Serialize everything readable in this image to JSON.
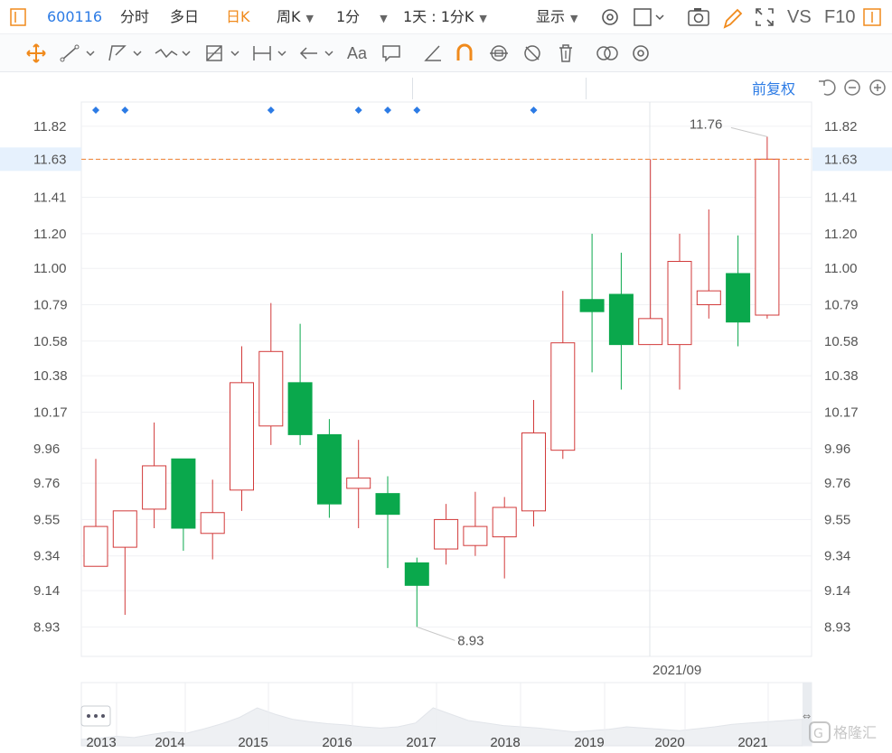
{
  "toolbar": {
    "code": "600116",
    "tab_fenshi": "分时",
    "tab_duori": "多日",
    "tab_rik": "日K",
    "tab_zhouk": "周K",
    "tab_1fen": "1分",
    "tab_1tian": "1天 : 1分K",
    "display": "显示",
    "vs": "VS",
    "f10": "F10"
  },
  "chart_header": {
    "adjust": "前复权"
  },
  "colors": {
    "up": "#d23a3a",
    "down": "#0aa84c",
    "accent": "#2c7be5",
    "highlight": "#f08030"
  },
  "chart_data": {
    "type": "candlestick",
    "xlabel": "",
    "ylabel": "",
    "ylim": [
      8.76,
      11.96
    ],
    "y_ticks": [
      "11.82",
      "11.63",
      "11.41",
      "11.20",
      "11.00",
      "10.79",
      "10.58",
      "10.38",
      "10.17",
      "9.96",
      "9.76",
      "9.55",
      "9.34",
      "9.14",
      "8.93"
    ],
    "current_price": "11.63",
    "max_label": "11.76",
    "min_label": "8.93",
    "crosshair_date": "2021/09",
    "marker_indices": [
      0,
      1,
      6,
      9,
      10,
      11,
      15
    ],
    "candles": [
      {
        "open": 9.28,
        "close": 9.51,
        "high": 9.9,
        "low": 9.28
      },
      {
        "open": 9.39,
        "close": 9.6,
        "high": 9.6,
        "low": 9.0
      },
      {
        "open": 9.61,
        "close": 9.86,
        "high": 10.11,
        "low": 9.5
      },
      {
        "open": 9.9,
        "close": 9.5,
        "high": 9.9,
        "low": 9.37
      },
      {
        "open": 9.47,
        "close": 9.59,
        "high": 9.78,
        "low": 9.32
      },
      {
        "open": 9.72,
        "close": 10.34,
        "high": 10.55,
        "low": 9.6
      },
      {
        "open": 10.09,
        "close": 10.52,
        "high": 10.8,
        "low": 9.98
      },
      {
        "open": 10.34,
        "close": 10.04,
        "high": 10.68,
        "low": 9.98
      },
      {
        "open": 10.04,
        "close": 9.64,
        "high": 10.13,
        "low": 9.56
      },
      {
        "open": 9.73,
        "close": 9.79,
        "high": 10.01,
        "low": 9.5
      },
      {
        "open": 9.7,
        "close": 9.58,
        "high": 9.8,
        "low": 9.27
      },
      {
        "open": 9.3,
        "close": 9.17,
        "high": 9.33,
        "low": 8.93
      },
      {
        "open": 9.38,
        "close": 9.55,
        "high": 9.64,
        "low": 9.29
      },
      {
        "open": 9.4,
        "close": 9.51,
        "high": 9.71,
        "low": 9.34
      },
      {
        "open": 9.45,
        "close": 9.62,
        "high": 9.68,
        "low": 9.21
      },
      {
        "open": 9.6,
        "close": 10.05,
        "high": 10.24,
        "low": 9.51
      },
      {
        "open": 9.95,
        "close": 10.57,
        "high": 10.87,
        "low": 9.9
      },
      {
        "open": 10.82,
        "close": 10.75,
        "high": 11.2,
        "low": 10.4
      },
      {
        "open": 10.85,
        "close": 10.56,
        "high": 11.09,
        "low": 10.3
      },
      {
        "open": 10.56,
        "close": 10.71,
        "high": 11.63,
        "low": 10.56
      },
      {
        "open": 10.56,
        "close": 11.04,
        "high": 11.2,
        "low": 10.3
      },
      {
        "open": 10.79,
        "close": 10.87,
        "high": 11.34,
        "low": 10.71
      },
      {
        "open": 10.97,
        "close": 10.69,
        "high": 11.19,
        "low": 10.55
      },
      {
        "open": 10.73,
        "close": 11.63,
        "high": 11.76,
        "low": 10.71
      }
    ],
    "navigator_years": [
      "2013",
      "2014",
      "2015",
      "2016",
      "2017",
      "2018",
      "2019",
      "2020",
      "2021"
    ],
    "navigator_series": [
      0.1,
      0.12,
      0.15,
      0.13,
      0.18,
      0.22,
      0.2,
      0.27,
      0.35,
      0.45,
      0.6,
      0.5,
      0.42,
      0.38,
      0.35,
      0.33,
      0.3,
      0.28,
      0.3,
      0.36,
      0.6,
      0.5,
      0.4,
      0.36,
      0.32,
      0.3,
      0.28,
      0.25,
      0.22,
      0.24,
      0.26,
      0.3,
      0.28,
      0.26,
      0.24,
      0.27,
      0.3,
      0.34,
      0.36,
      0.38,
      0.4,
      0.42
    ]
  }
}
